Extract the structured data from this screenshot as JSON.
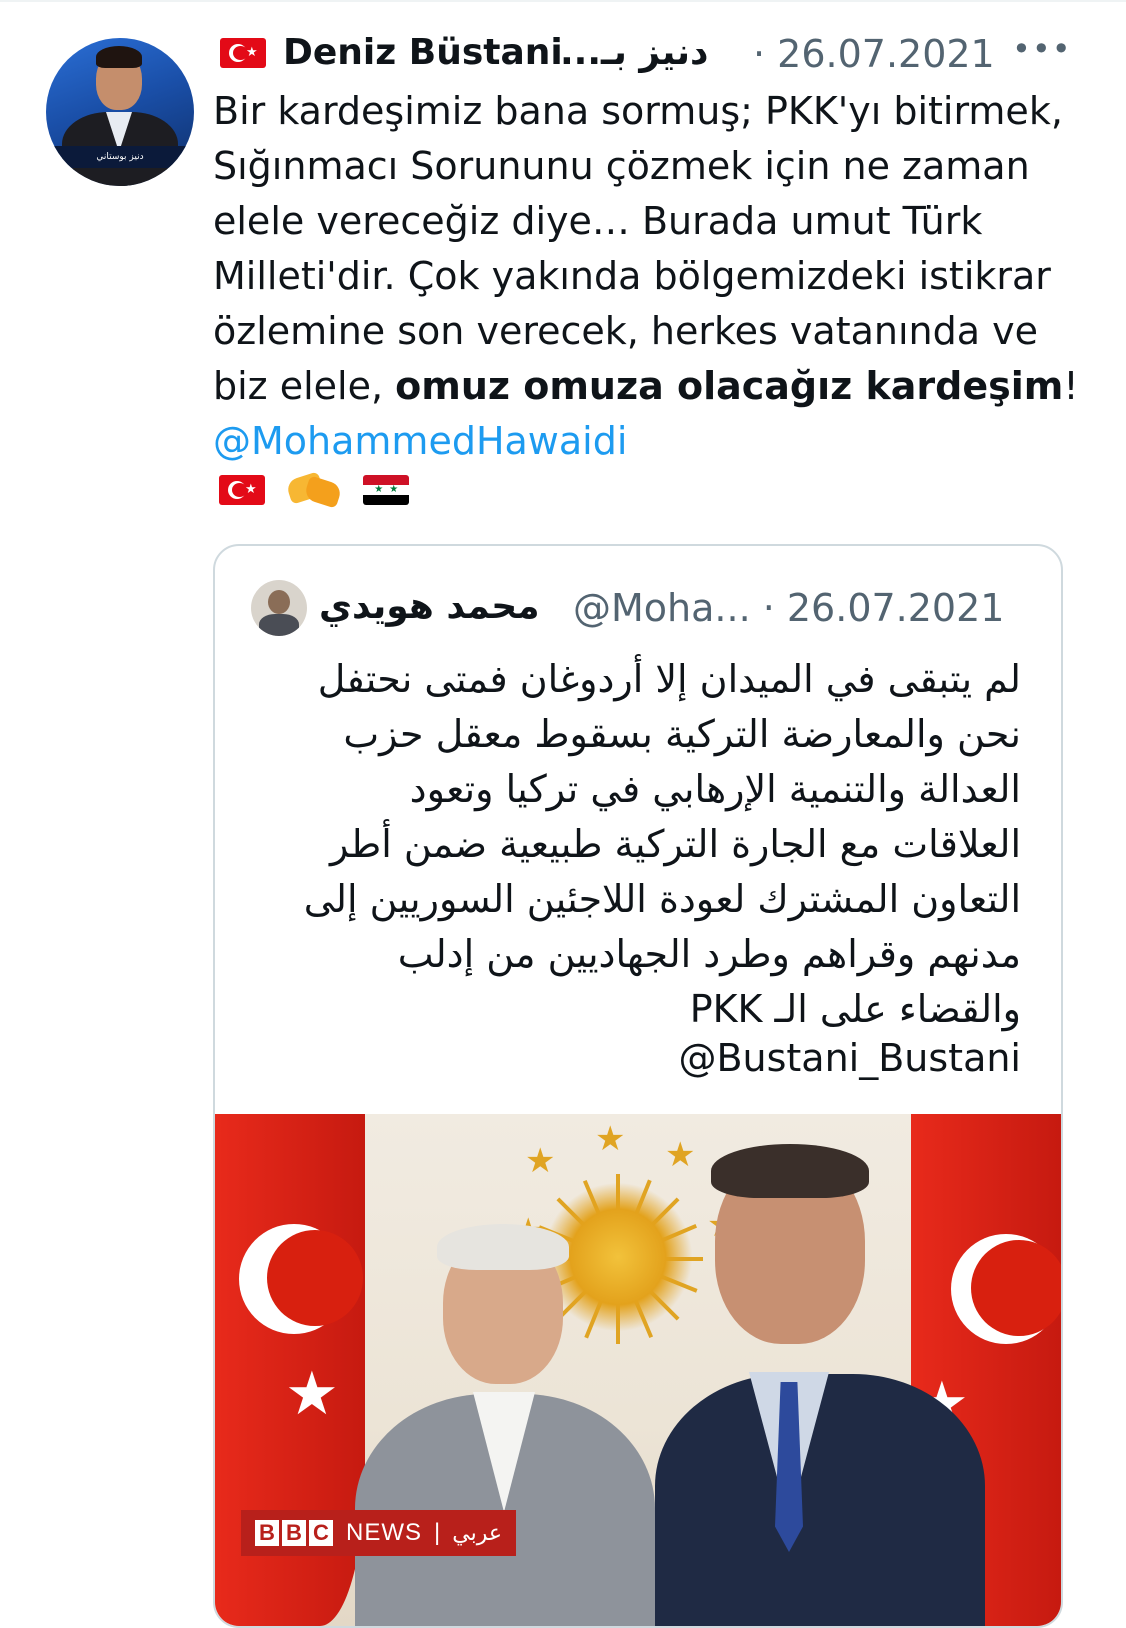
{
  "tweet": {
    "author_name": "Deniz Büstani",
    "author_name_ar": "دنيز بـ...",
    "date": "· 26.07.2021",
    "more": "•••",
    "text_lines": [
      "Bir kardeşimiz bana sormuş; PKK'yı bitirmek,",
      "Sığınmacı Sorununu çözmek için ne zaman",
      "elele vereceğiz diye… Burada umut Türk",
      "Milleti'dir. Çok yakında bölgemizdeki istikrar",
      "özlemine son verecek, herkes vatanında ve"
    ],
    "last_line_plain": "biz elele, ",
    "last_line_bold": "omuz omuza olacağız kardeşim",
    "last_line_end": "!",
    "mention": "@MohammedHawaidi",
    "avatar_caption": "دنيز بوستاني"
  },
  "quote": {
    "author_name": "محمد هويدي",
    "handle_date": "@Moha... · 26.07.2021",
    "text_lines": [
      "لم يتبقى في الميدان إلا أردوغان فمتى نحتفل",
      "نحن والمعارضة التركية بسقوط معقل حزب",
      "العدالة والتنمية الإرهابي في تركيا وتعود",
      "العلاقات مع الجارة التركية طبيعية ضمن أطر",
      "التعاون المشترك لعودة اللاجئين السوريين إلى",
      "مدنهم وقراهم وطرد الجهاديين من إدلب",
      "والقضاء على الـ PKK"
    ],
    "mention": "@Bustani_Bustani",
    "image_badge": {
      "b1": "B",
      "b2": "B",
      "b3": "C",
      "news": "NEWS",
      "sep": "|",
      "ar": "عربي"
    }
  },
  "icons": {
    "flag_tr": "turkey-flag-icon",
    "handshake": "handshake-icon",
    "flag_sy": "syria-flag-icon"
  },
  "colors": {
    "link": "#1d9bf0",
    "secondary_text": "#536471",
    "card_border": "#cfd9de"
  }
}
